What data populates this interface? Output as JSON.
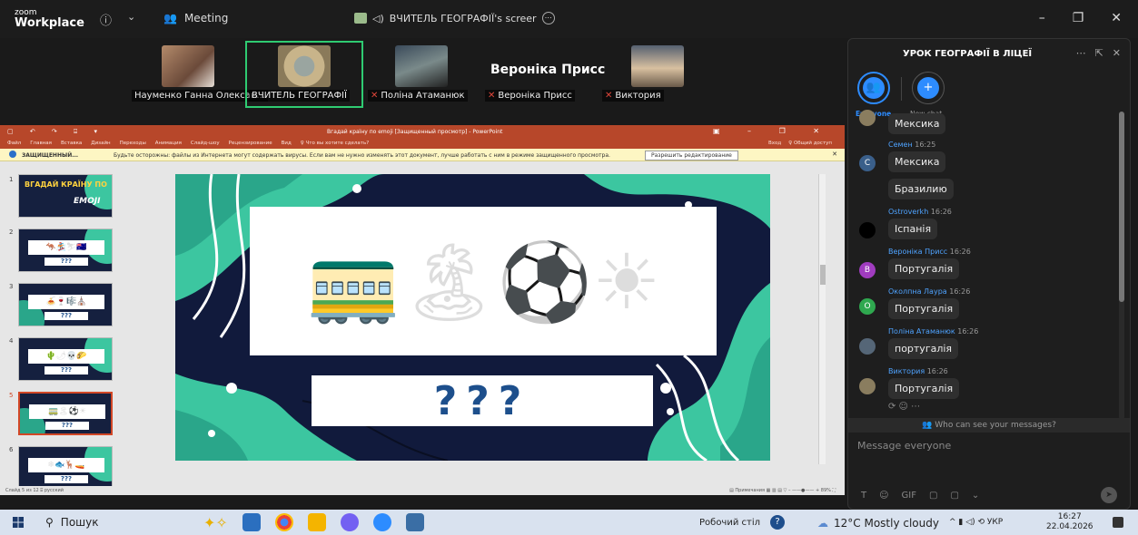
{
  "titlebar": {
    "brand_small": "zoom",
    "brand_big": "Workplace",
    "info_icon": "info-icon",
    "meeting_label": "Meeting",
    "share_label": "ВЧИТЕЛЬ ГЕОГРАФІЇ's screer",
    "ctrls": [
      "–",
      "❐",
      "✕"
    ]
  },
  "participants": [
    {
      "name": "Науменко Ганна Олексан...",
      "muted": false
    },
    {
      "name": "ВЧИТЕЛЬ ГЕОГРАФІЇ",
      "muted": false,
      "active": true
    },
    {
      "name": "Поліна Атаманюк",
      "muted": true
    },
    {
      "name": "Вероніка Присс",
      "muted": true
    },
    {
      "name": "Виктория",
      "muted": true
    }
  ],
  "speaker_name": "Вероніка Присс",
  "ppt": {
    "quick_access": "▢ ↶ ↷ ⌹ ▾",
    "title": "Вгадай країну по emoji [Защищенный просмотр] - PowerPoint",
    "window_ctrls": "▣ – ❐ ✕",
    "tabs": [
      "Файл",
      "Главная",
      "Вставка",
      "Дизайн",
      "Переходы",
      "Анимация",
      "Слайд-шоу",
      "Рецензирование",
      "Вид",
      "♀ Что вы хотите сделать?"
    ],
    "ribbon_right": [
      "Вход",
      "♀ Общий доступ"
    ],
    "protect_title": "ЗАЩИЩЕННЫЙ...",
    "protect_text": "Будьте осторожны: файлы из Интернета могут содержать вирусы. Если вам не нужно изменять этот документ, лучше работать с ним в режиме защищенного просмотра.",
    "protect_button": "Разрешить редактирование",
    "thumb1_title": "ВГАДАЙ КРАЇНУ ПО",
    "thumb1_emoji": "EMOJI",
    "thumbs": [
      {
        "num": "1",
        "emoji": ""
      },
      {
        "num": "2",
        "emoji": "🦘🏂⛷🇦🇺"
      },
      {
        "num": "3",
        "emoji": "🍝🍷🎼⛪"
      },
      {
        "num": "4",
        "emoji": "🌵🌶💀🌮"
      },
      {
        "num": "5",
        "emoji": "🚃🏝⚽☀"
      },
      {
        "num": "6",
        "emoji": "❄🐟🦌🚤"
      }
    ],
    "thumb_q": "???",
    "slide_emoji": "🚃🏝⚽☀",
    "slide_question": "???",
    "status_left": "Слайд 5 из 12   ⌹   русский",
    "status_right": "▤ Примечания   ▦  ▥  ▤  ▽  –  ——●——  +  89%  ⛶"
  },
  "chat": {
    "title": "УРОК ГЕОГРАФІЇ В ЛІЦЕЇ",
    "head_ctrls": [
      "⋯",
      "⇱",
      "✕"
    ],
    "tab_everyone": "Everyone",
    "tab_newchat": "New chat",
    "messages": [
      {
        "author": "",
        "time": "",
        "text": "Мексика",
        "avatar": "",
        "avatar_color": "#8a7d5f"
      },
      {
        "author": "Семен",
        "time": "16:25",
        "text": "Мексика",
        "avatar": "C",
        "avatar_color": "#3a5f8a"
      },
      {
        "author": "",
        "time": "",
        "text": "Бразилию",
        "avatar": "",
        "avatar_color": ""
      },
      {
        "author": "Ostroverkh",
        "time": "16:26",
        "text": "Іспанія",
        "avatar": "",
        "avatar_color": "#000000"
      },
      {
        "author": "Вероніка Присс",
        "time": "16:26",
        "text": "Португалія",
        "avatar": "B",
        "avatar_color": "#a03cbf"
      },
      {
        "author": "Околпна Лаура",
        "time": "16:26",
        "text": "Португалія",
        "avatar": "O",
        "avatar_color": "#2fa84f"
      },
      {
        "author": "Поліна Атаманюк",
        "time": "16:26",
        "text": "португалія",
        "avatar": "",
        "avatar_color": "#556677"
      },
      {
        "author": "Виктория",
        "time": "16:26",
        "text": "Португалія",
        "avatar": "",
        "avatar_color": "#8a7d5f"
      }
    ],
    "reactions": "⟳  ☺  ⋯",
    "who_can_see": "Who can see your messages?",
    "compose_placeholder": "Message everyone",
    "tools": [
      "T",
      "☺",
      "GIF",
      "▢",
      "▢",
      "⌄"
    ]
  },
  "taskbar": {
    "search_label": "Пошук",
    "desktop_label": "Робочий стіл",
    "weather": "12°C  Mostly cloudy",
    "tray": "^  ▮  ◁)  ⟲  УКР",
    "time": "16:27",
    "date": "22.04.2026"
  },
  "colors": {
    "zoom_blue": "#2d8cff",
    "ppt_red": "#b7472a",
    "active_green": "#2fcb72",
    "slide_teal": "#3cc6a0",
    "slide_navy": "#111a3c",
    "question_blue": "#1d4f8c"
  }
}
